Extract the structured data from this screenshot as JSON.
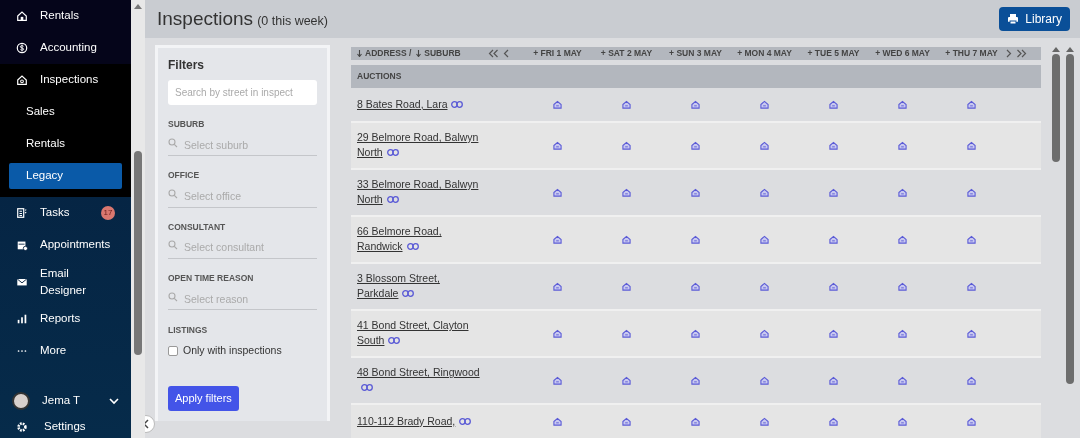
{
  "sidebar": {
    "items": [
      {
        "label": "Rentals",
        "expanded": false
      },
      {
        "label": "Accounting",
        "expanded": false
      },
      {
        "label": "Inspections",
        "expanded": true,
        "children": [
          {
            "label": "Sales",
            "selected": false
          },
          {
            "label": "Rentals",
            "selected": false
          },
          {
            "label": "Legacy",
            "selected": true
          }
        ]
      },
      {
        "label": "Tasks",
        "expanded": false,
        "badge": "17"
      },
      {
        "label": "Appointments",
        "expanded": false
      },
      {
        "label": "Email Designer",
        "expanded": false
      },
      {
        "label": "Reports",
        "expanded": false
      },
      {
        "label": "More",
        "expanded": false
      }
    ],
    "user": {
      "name": "Jema T"
    },
    "settings": {
      "label": "Settings"
    }
  },
  "header": {
    "title": "Inspections",
    "subtitle": "(0 this week)",
    "button": "Library"
  },
  "filters": {
    "title": "Filters",
    "search": {
      "placeholder": "Search by street in inspect"
    },
    "fields": [
      {
        "label": "SUBURB",
        "placeholder": "Select suburb"
      },
      {
        "label": "OFFICE",
        "placeholder": "Select office"
      },
      {
        "label": "CONSULTANT",
        "placeholder": "Select consultant"
      },
      {
        "label": "OPEN TIME REASON",
        "placeholder": "Select reason"
      }
    ],
    "listings": {
      "label": "LISTINGS",
      "option": "Only with inspections",
      "checked": false
    },
    "apply": "Apply filters"
  },
  "table": {
    "columns": {
      "address": "ADDRESS /",
      "suburb": "SUBURB",
      "days": [
        "+ FRI 1 MAY",
        "+ SAT 2 MAY",
        "+ SUN 3 MAY",
        "+ MON 4 MAY",
        "+ TUE 5 MAY",
        "+ WED 6 MAY",
        "+ THU 7 MAY"
      ]
    },
    "groups": [
      {
        "label": "AUCTIONS",
        "rows": [
          {
            "address": "8 Bates Road, Lara",
            "slots": [
              true,
              true,
              true,
              true,
              true,
              true,
              true
            ]
          },
          {
            "address": "29 Belmore Road, Balwyn North",
            "slots": [
              true,
              true,
              true,
              true,
              true,
              true,
              true
            ]
          },
          {
            "address": "33 Belmore Road, Balwyn North",
            "slots": [
              true,
              true,
              true,
              true,
              true,
              true,
              true
            ]
          },
          {
            "address": "66 Belmore Road, Randwick",
            "slots": [
              true,
              true,
              true,
              true,
              true,
              true,
              true
            ]
          },
          {
            "address": "3 Blossom Street, Parkdale",
            "slots": [
              true,
              true,
              true,
              true,
              true,
              true,
              true
            ]
          },
          {
            "address": "41 Bond Street, Clayton South",
            "slots": [
              true,
              true,
              true,
              true,
              true,
              true,
              true
            ]
          },
          {
            "address": "48 Bond Street, Ringwood",
            "slots": [
              true,
              true,
              true,
              true,
              true,
              true,
              true
            ]
          },
          {
            "address": "110-112 Brady Road,",
            "slots": [
              true,
              true,
              true,
              true,
              true,
              true,
              true
            ]
          }
        ]
      }
    ]
  }
}
